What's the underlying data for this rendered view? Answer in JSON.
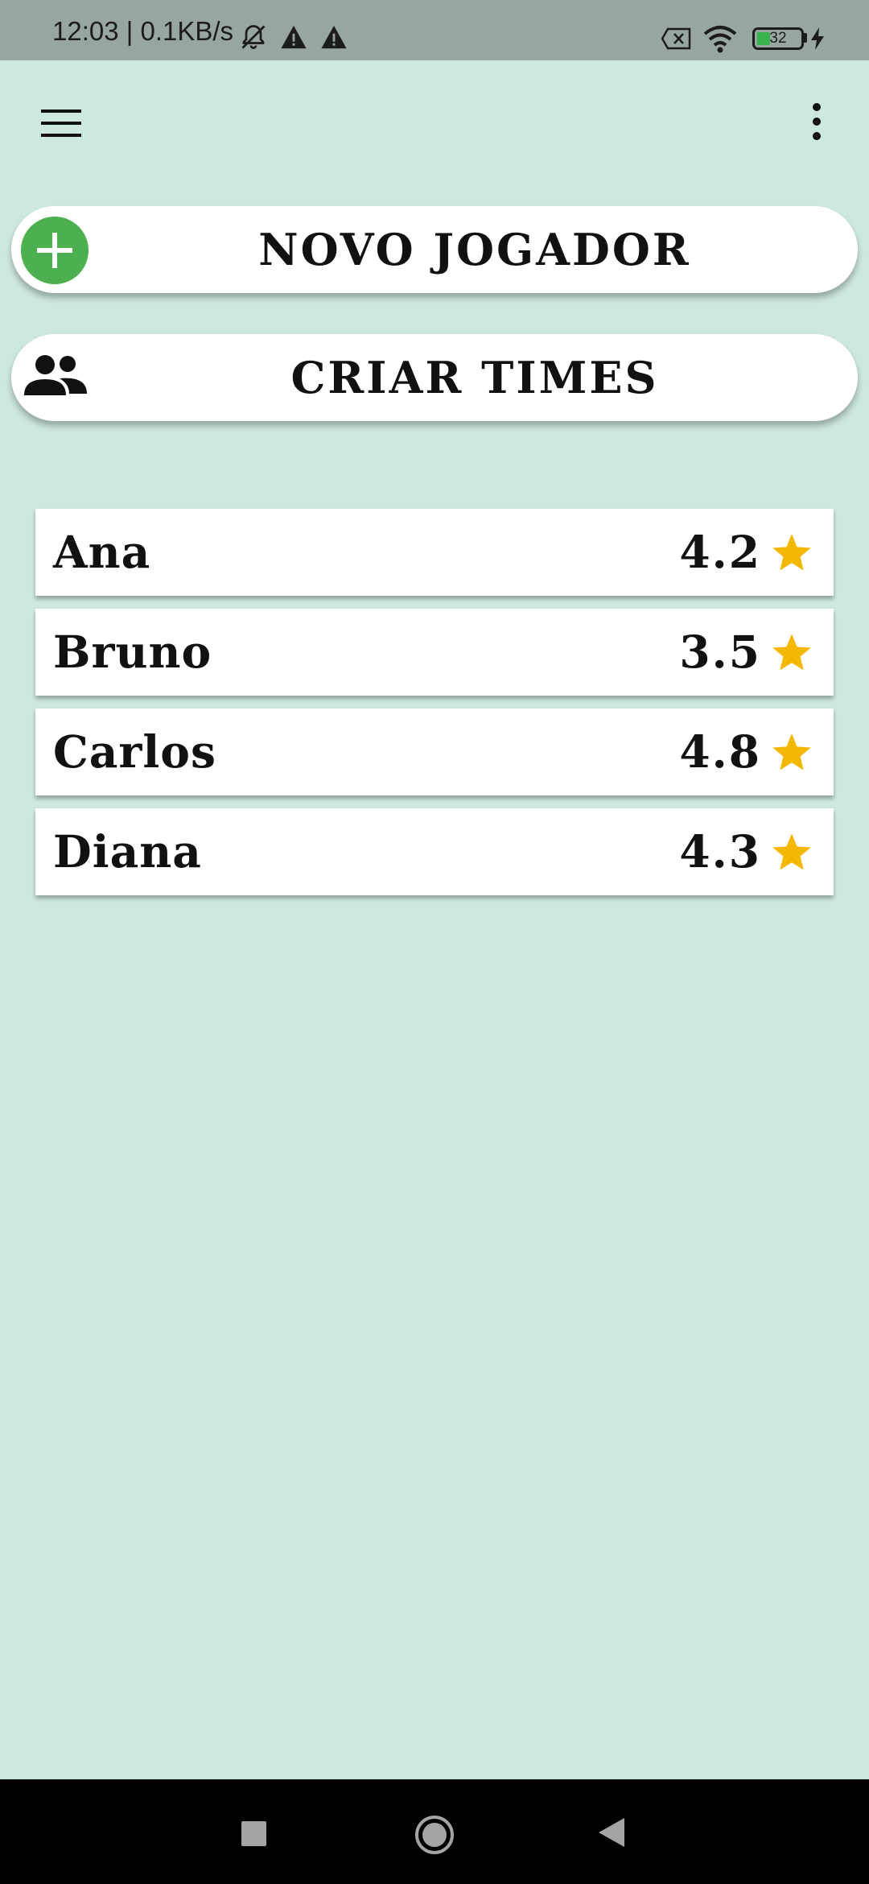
{
  "status_bar": {
    "time_speed": "12:03 | 0.1KB/s",
    "battery_level": "32",
    "icons": [
      "muted-bell-icon",
      "warning-icon",
      "warning-icon",
      "close-box-icon",
      "wifi-icon",
      "battery-icon",
      "charging-icon"
    ]
  },
  "toolbar": {
    "menu_icon": "hamburger-menu-icon",
    "more_icon": "more-vertical-icon"
  },
  "actions": {
    "new_player_label": "NOVO JOGADOR",
    "create_teams_label": "CRIAR TIMES"
  },
  "players": [
    {
      "name": "Ana",
      "rating": "4.2"
    },
    {
      "name": "Bruno",
      "rating": "3.5"
    },
    {
      "name": "Carlos",
      "rating": "4.8"
    },
    {
      "name": "Diana",
      "rating": "4.3"
    }
  ],
  "colors": {
    "background": "#cde8df",
    "status_bar": "#97a6a0",
    "accent_green": "#4caf50",
    "star": "#f5b800"
  },
  "nav_bar": [
    "recents-button",
    "home-button",
    "back-button"
  ]
}
